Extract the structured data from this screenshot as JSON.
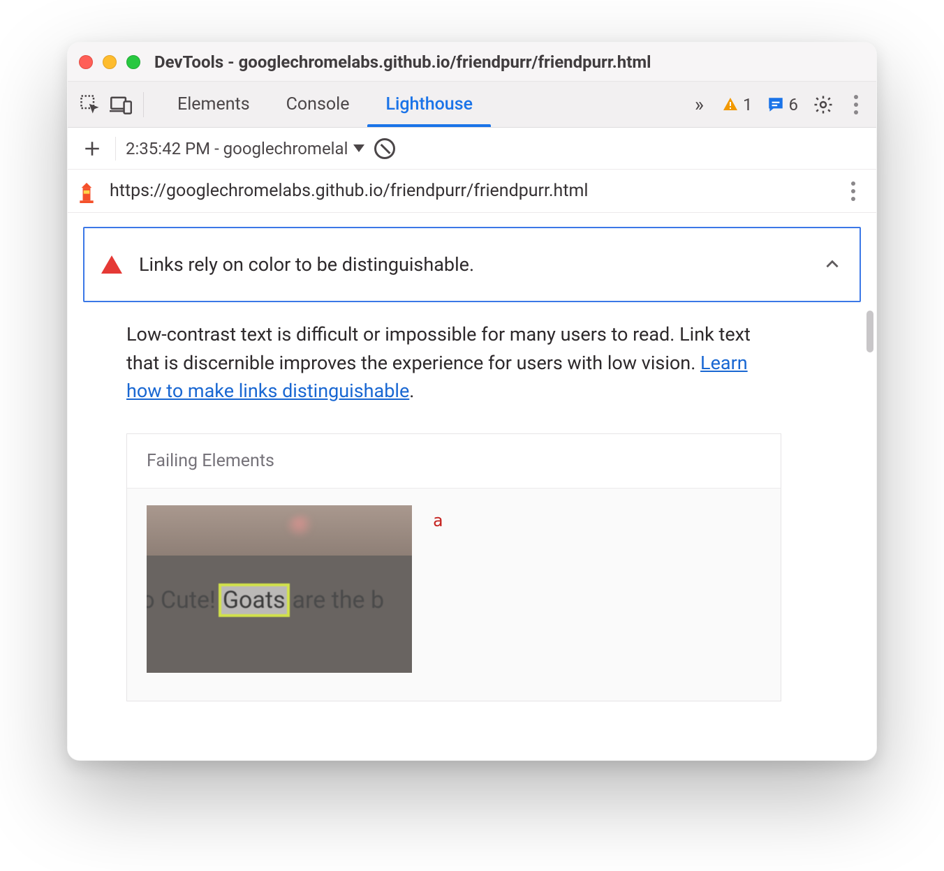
{
  "window": {
    "title": "DevTools - googlechromelabs.github.io/friendpurr/friendpurr.html"
  },
  "tabs": {
    "elements": "Elements",
    "console": "Console",
    "lighthouse": "Lighthouse"
  },
  "issues": {
    "warning_triangle": "▲",
    "warning_count": "1",
    "issues_count": "6"
  },
  "toolbar": {
    "report_label": "2:35:42 PM - googlechromelal"
  },
  "url": {
    "text": "https://googlechromelabs.github.io/friendpurr/friendpurr.html"
  },
  "audit": {
    "title": "Links rely on color to be distinguishable.",
    "desc_pre": "Low-contrast text is difficult or impossible for many users to read. Link text that is discernible improves the experience for users with low vision. ",
    "learn_link": "Learn how to make links distinguishable",
    "desc_post": "."
  },
  "failing": {
    "header": "Failing Elements",
    "snippet_pre": "So Cute! ",
    "snippet_hl": "Goats",
    "snippet_post": " are the b",
    "tag": "a"
  }
}
